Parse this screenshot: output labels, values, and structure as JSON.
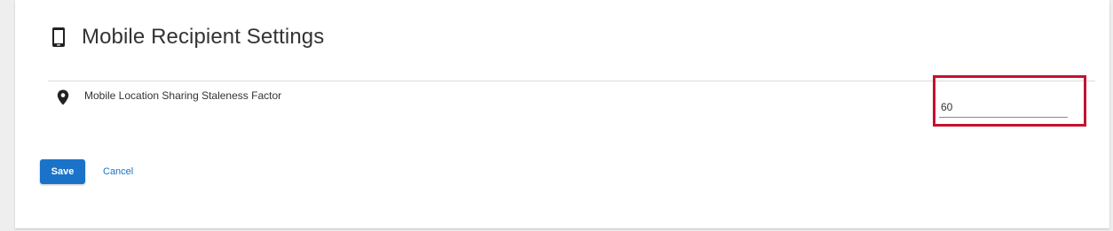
{
  "section": {
    "title": "Mobile Recipient Settings",
    "title_icon": "mobile-phone-icon"
  },
  "settings": [
    {
      "label": "Mobile Location Sharing Staleness Factor",
      "icon": "location-pin-icon",
      "value": "60"
    }
  ],
  "actions": {
    "save_label": "Save",
    "cancel_label": "Cancel"
  },
  "colors": {
    "accent": "#1a73c8",
    "highlight_border": "#c4122f",
    "text": "#333333"
  }
}
